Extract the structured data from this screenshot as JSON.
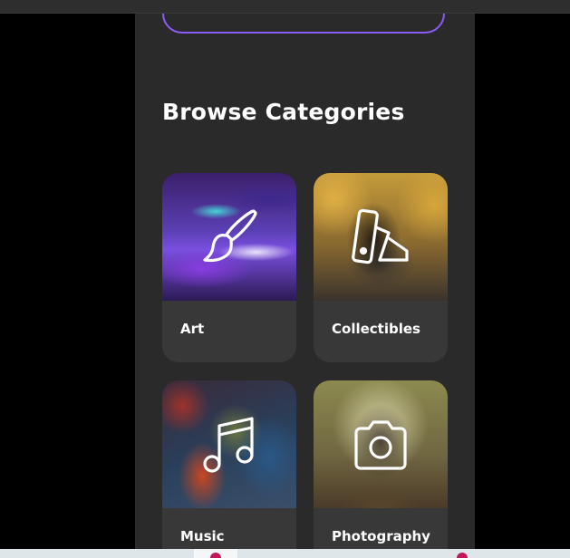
{
  "section": {
    "title": "Browse Categories"
  },
  "categories": [
    {
      "label": "Art",
      "icon": "paintbrush-icon"
    },
    {
      "label": "Collectibles",
      "icon": "swatch-book-icon"
    },
    {
      "label": "Music",
      "icon": "music-note-icon"
    },
    {
      "label": "Photography",
      "icon": "camera-icon"
    }
  ],
  "colors": {
    "panel_bg": "#2a2a2a",
    "card_bg": "#383838",
    "accent_border": "#8b5cf6",
    "text": "#ffffff"
  }
}
